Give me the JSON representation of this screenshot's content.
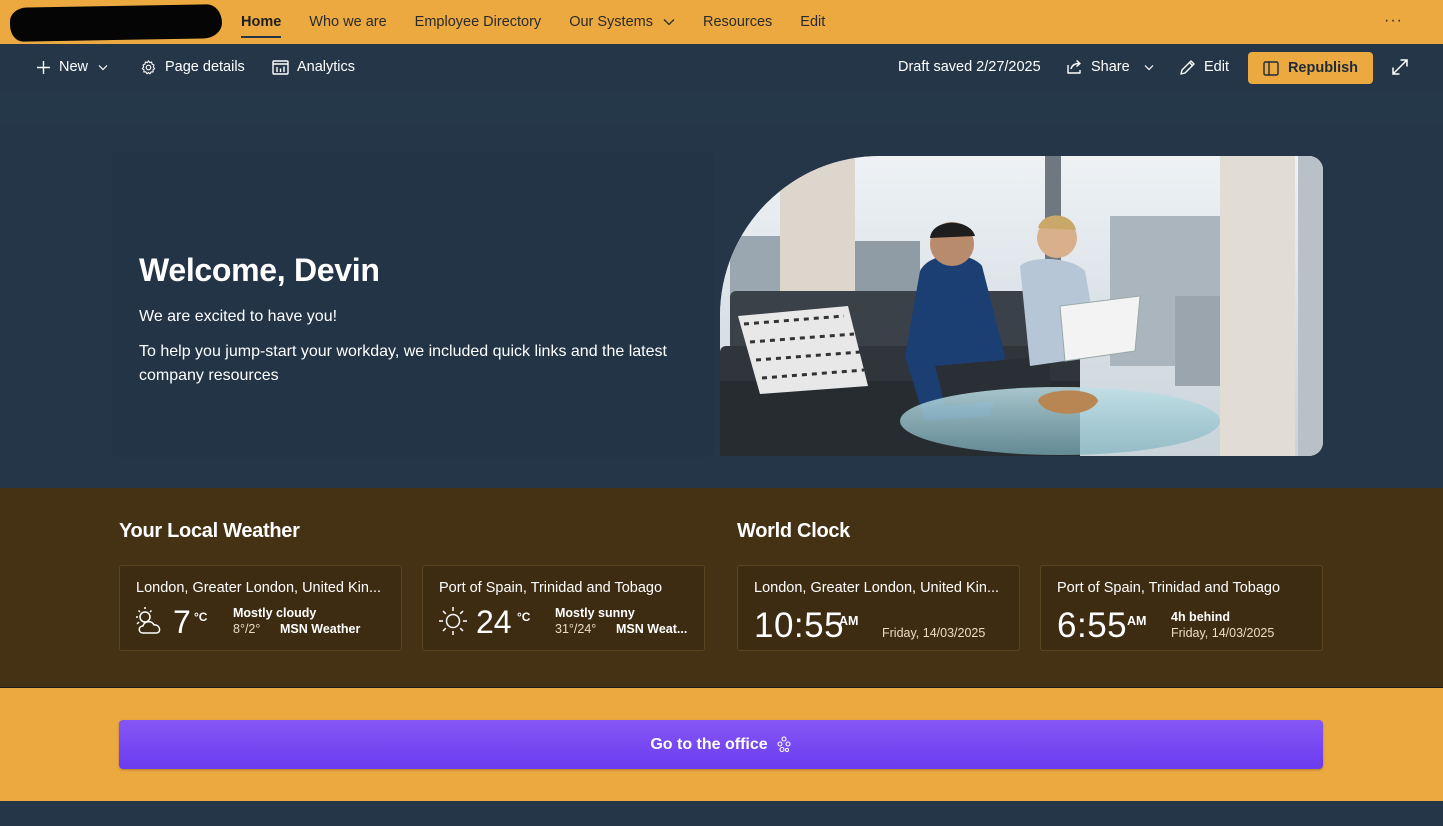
{
  "nav": {
    "items": [
      {
        "label": "Home",
        "active": true
      },
      {
        "label": "Who we are"
      },
      {
        "label": "Employee Directory"
      },
      {
        "label": "Our Systems",
        "has_dropdown": true
      },
      {
        "label": "Resources"
      },
      {
        "label": "Edit"
      }
    ],
    "more_icon": "ellipsis-icon"
  },
  "commandbar": {
    "new_label": "New",
    "page_details_label": "Page details",
    "analytics_label": "Analytics",
    "draft_status": "Draft saved 2/27/2025",
    "share_label": "Share",
    "edit_label": "Edit",
    "republish_label": "Republish"
  },
  "hero": {
    "title": "Welcome, Devin",
    "line1": "We are excited to have you!",
    "line2": "To help you jump-start your workday, we included quick links and the latest company resources"
  },
  "weather": {
    "section_title": "Your Local Weather",
    "tiles": [
      {
        "location": "London, Greater London, United Kin...",
        "temp": "7",
        "unit": "°C",
        "condition": "Mostly cloudy",
        "range": "8°/2°",
        "source": "MSN Weather",
        "icon": "partly-cloudy-icon"
      },
      {
        "location": "Port of Spain, Trinidad and Tobago",
        "temp": "24",
        "unit": "°C",
        "condition": "Mostly sunny",
        "range": "31°/24°",
        "source": "MSN Weat...",
        "icon": "sunny-icon"
      }
    ]
  },
  "clock": {
    "section_title": "World Clock",
    "tiles": [
      {
        "location": "London, Greater London, United Kin...",
        "time": "10:55",
        "ampm": "AM",
        "date": "Friday, 14/03/2025"
      },
      {
        "location": "Port of Spain, Trinidad and Tobago",
        "time": "6:55",
        "ampm": "AM",
        "offset": "4h behind",
        "date": "Friday, 14/03/2025"
      }
    ]
  },
  "cta": {
    "label": "Go to the office"
  },
  "colors": {
    "accent": "#eba940",
    "dark_navy": "#243647",
    "brown_band": "#453114",
    "cta_purple": "#7447f2"
  }
}
